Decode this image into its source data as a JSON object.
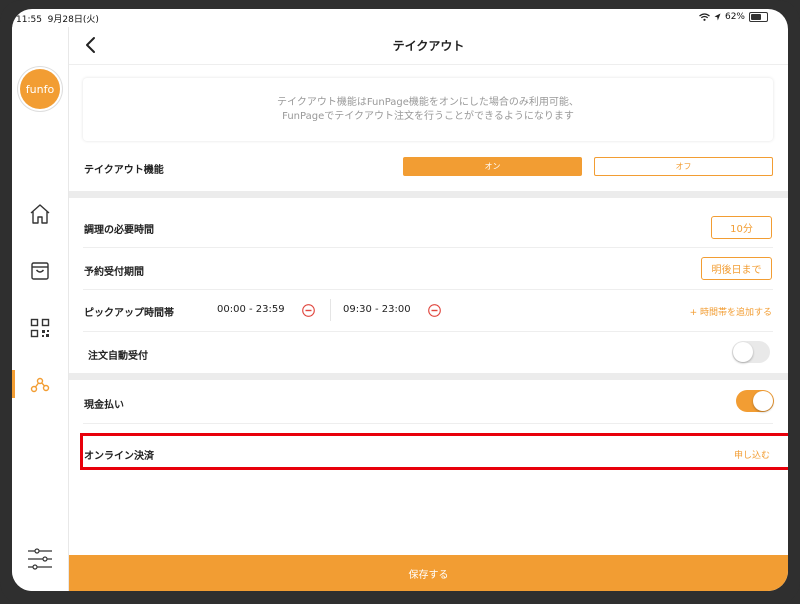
{
  "status": {
    "time": "11:55",
    "date": "9月28日(火)",
    "battery": "62%"
  },
  "sidebar": {
    "logo": "funfo",
    "items": [
      {
        "icon": "home-icon"
      },
      {
        "icon": "bag-icon"
      },
      {
        "icon": "qr-code-icon"
      },
      {
        "icon": "share-nodes-icon",
        "active": true
      },
      {
        "icon": "sliders-icon"
      }
    ]
  },
  "header": {
    "title": "テイクアウト"
  },
  "info": {
    "line1": "テイクアウト機能はFunPage機能をオンにした場合のみ利用可能、",
    "line2": "FunPageでテイクアウト注文を行うことができるようになります"
  },
  "takeout": {
    "label": "テイクアウト機能",
    "on": "オン",
    "off": "オフ",
    "selected": "オン"
  },
  "prep_time": {
    "label": "調理の必要時間",
    "value": "10分"
  },
  "reserve": {
    "label": "予約受付期間",
    "value": "明後日まで"
  },
  "pickup": {
    "label": "ピックアップ時間帯",
    "range1": "00:00 - 23:59",
    "range2": "09:30 - 23:00",
    "add": "+ 時間帯を追加する"
  },
  "auto_accept": {
    "label": "注文自動受付",
    "enabled": false
  },
  "cash": {
    "label": "現金払い",
    "enabled": true
  },
  "online": {
    "label": "オンライン決済",
    "action": "申し込む"
  },
  "footer": {
    "save": "保存する"
  },
  "colors": {
    "accent": "#f29d33",
    "highlight": "#e8000b",
    "minus": "#e0473f"
  }
}
